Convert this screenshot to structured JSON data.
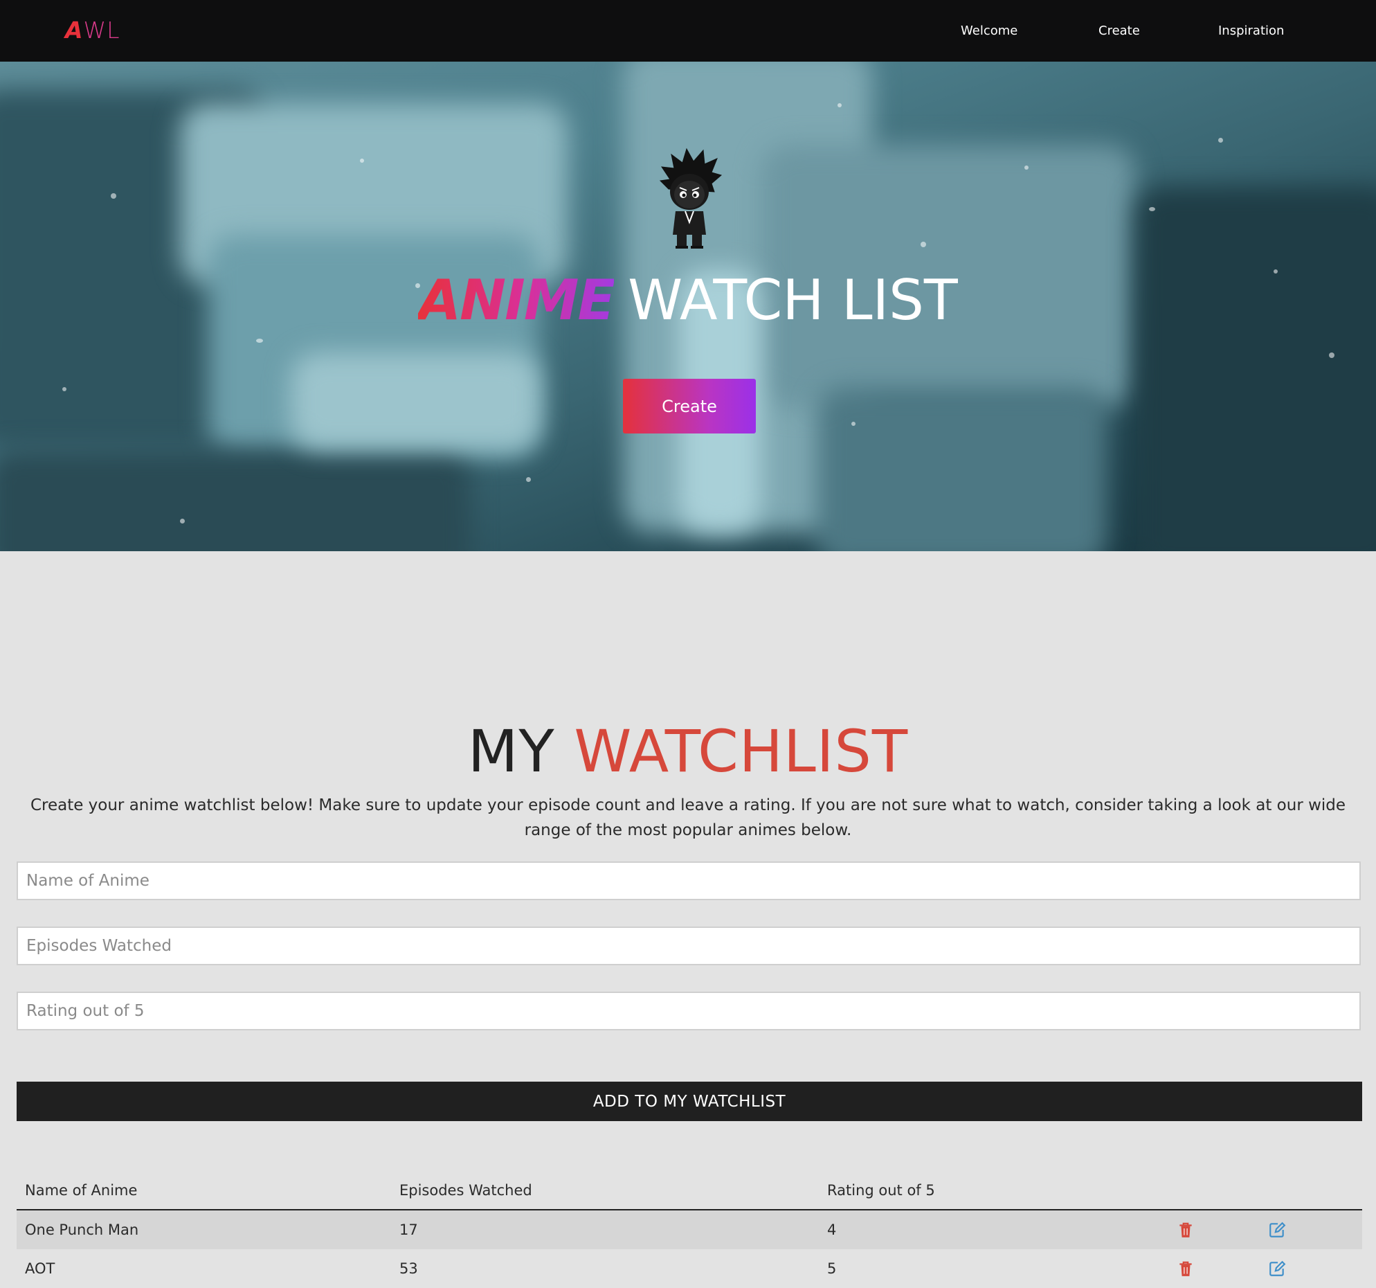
{
  "nav": {
    "logo_first": "A",
    "logo_rest": "WL",
    "links": [
      "Welcome",
      "Create",
      "Inspiration"
    ]
  },
  "hero": {
    "title_accent": "ANIME",
    "title_rest": "WATCH LIST",
    "create_label": "Create"
  },
  "watchlist": {
    "title_dark": "MY",
    "title_red": "WATCHLIST",
    "intro": "Create your anime watchlist below! Make sure to update your episode count and leave a rating. If you are not sure what to watch, consider taking a look at our wide range of the most popular animes below.",
    "name_placeholder": "Name of Anime",
    "episodes_placeholder": "Episodes Watched",
    "rating_placeholder": "Rating out of 5",
    "add_label": "ADD TO MY WATCHLIST"
  },
  "table": {
    "headers": [
      "Name of Anime",
      "Episodes Watched",
      "Rating out of 5"
    ],
    "rows": [
      {
        "name": "One Punch Man",
        "episodes": "17",
        "rating": "4"
      },
      {
        "name": "AOT",
        "episodes": "53",
        "rating": "5"
      }
    ]
  },
  "icons": {
    "delete": "trash-icon",
    "edit": "edit-icon",
    "mascot": "anime-character-icon"
  },
  "colors": {
    "accent_red": "#e8313b",
    "accent_purple": "#a33be0",
    "title_red": "#d6483b",
    "edit_blue": "#3f8fc9",
    "navbar": "#0e0e0f"
  }
}
